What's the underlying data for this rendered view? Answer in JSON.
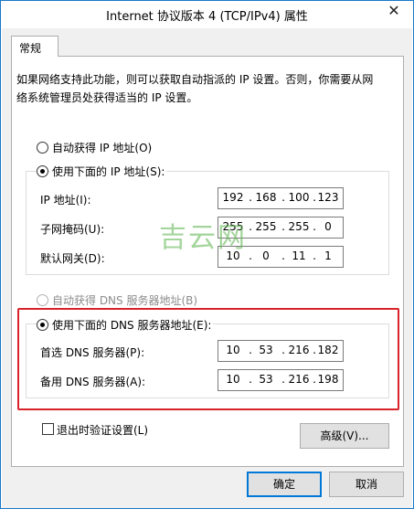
{
  "window": {
    "title": "Internet 协议版本 4 (TCP/IPv4) 属性",
    "close": "✕"
  },
  "tab": {
    "label": "常规"
  },
  "description": "如果网络支持此功能，则可以获取自动指派的 IP 设置。否则，你需要从网络系统管理员处获得适当的 IP 设置。",
  "ip": {
    "auto_label": "自动获得 IP 地址(O)",
    "manual_label": "使用下面的 IP 地址(S):",
    "address": {
      "label": "IP 地址(I):",
      "octets": [
        "192",
        "168",
        "100",
        "123"
      ]
    },
    "subnet": {
      "label": "子网掩码(U):",
      "octets": [
        "255",
        "255",
        "255",
        "0"
      ]
    },
    "gateway": {
      "label": "默认网关(D):",
      "octets": [
        "10",
        "0",
        "11",
        "1"
      ]
    }
  },
  "dns": {
    "auto_label": "自动获得 DNS 服务器地址(B)",
    "manual_label": "使用下面的 DNS 服务器地址(E):",
    "preferred": {
      "label": "首选 DNS 服务器(P):",
      "octets": [
        "10",
        "53",
        "216",
        "182"
      ]
    },
    "alternate": {
      "label": "备用 DNS 服务器(A):",
      "octets": [
        "10",
        "53",
        "216",
        "198"
      ]
    }
  },
  "validate_label": "退出时验证设置(L)",
  "advanced_label": "高级(V)...",
  "ok_label": "确定",
  "cancel_label": "取消",
  "watermark": "吉云网",
  "colors": {
    "highlight_box": "#d8232a",
    "watermark": "#5bb34c",
    "title_border": "#1979ca"
  }
}
